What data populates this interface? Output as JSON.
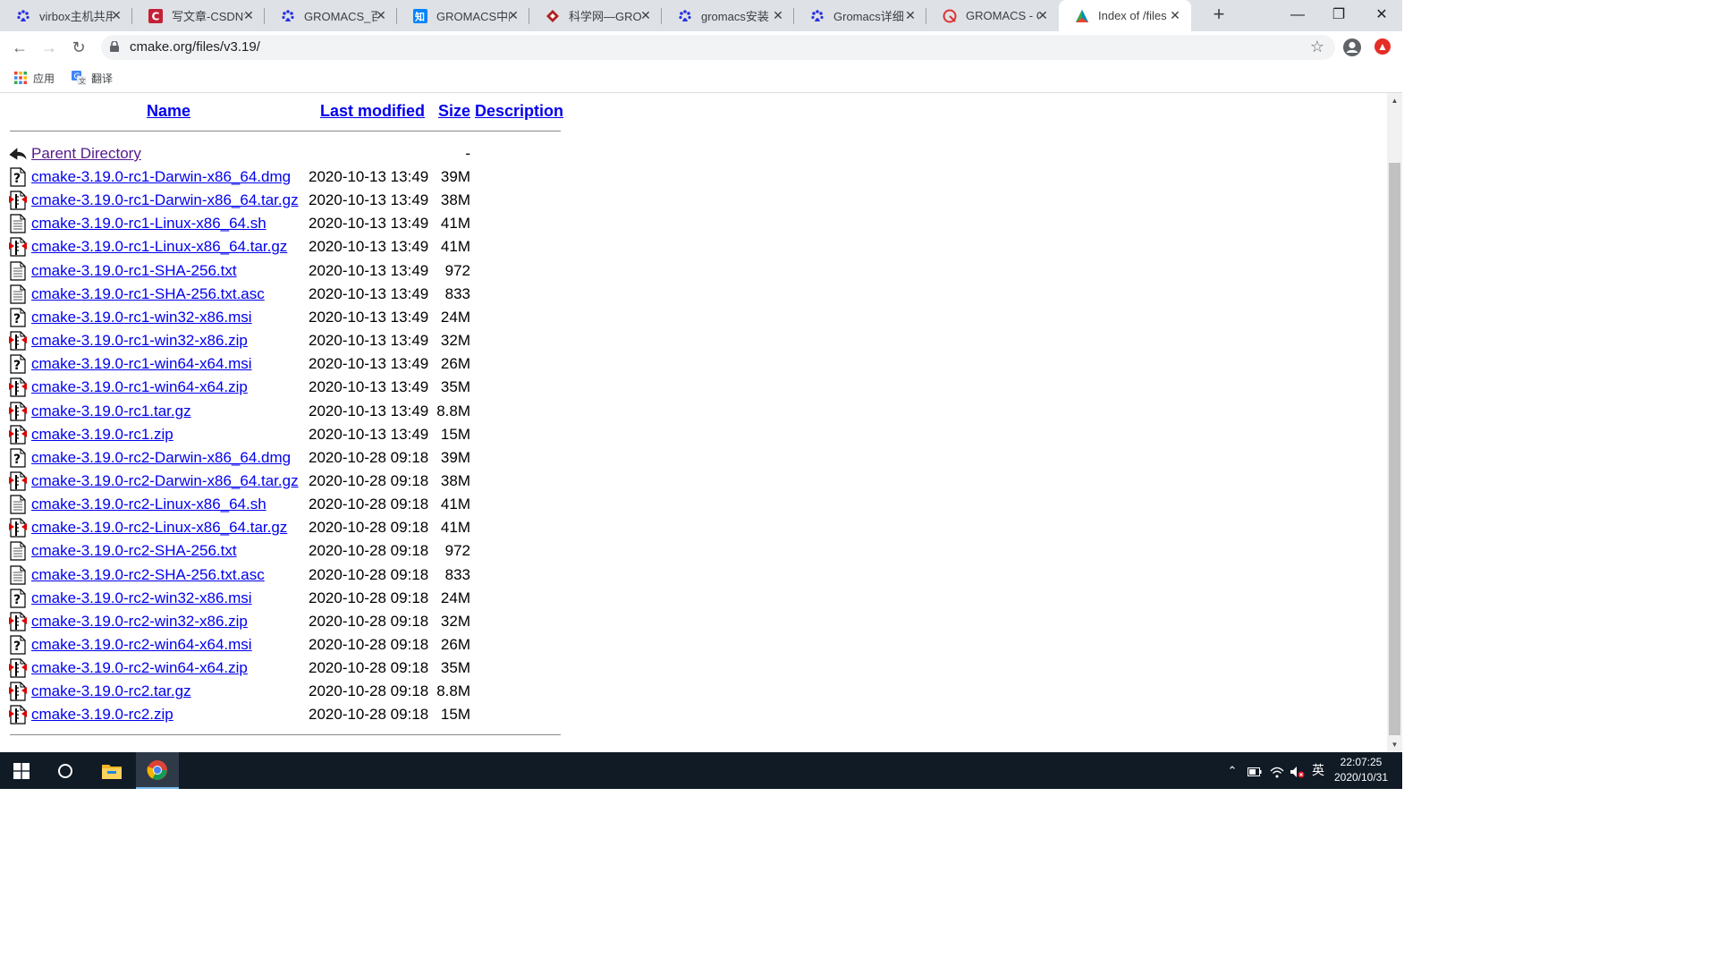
{
  "tabs": [
    {
      "title": "virbox主机共用",
      "icon": "baidu-paw-icon",
      "active": false
    },
    {
      "title": "写文章-CSDN博",
      "icon": "csdn-icon",
      "active": false
    },
    {
      "title": "GROMACS_百",
      "icon": "baidu-paw-icon",
      "active": false
    },
    {
      "title": "GROMACS中的",
      "icon": "zhihu-icon",
      "active": false
    },
    {
      "title": "科学网—GRO",
      "icon": "sciencenet-icon",
      "active": false
    },
    {
      "title": "gromacs安装",
      "icon": "baidu-paw-icon",
      "active": false
    },
    {
      "title": "Gromacs详细",
      "icon": "baidu-paw-icon",
      "active": false
    },
    {
      "title": "GROMACS - C",
      "icon": "gromacs-icon",
      "active": false
    },
    {
      "title": "Index of /files",
      "icon": "cmake-triangle-icon",
      "active": true
    }
  ],
  "address_bar": {
    "url": "cmake.org/files/v3.19/"
  },
  "bookmarks": [
    {
      "label": "应用",
      "icon": "apps-grid-icon"
    },
    {
      "label": "翻译",
      "icon": "translate-icon"
    }
  ],
  "listing": {
    "headers": {
      "name": "Name",
      "last_modified": "Last modified",
      "size": "Size",
      "description": "Description"
    },
    "parent": {
      "name": "Parent Directory",
      "size": "-",
      "icon": "back-arrow-icon"
    },
    "files": [
      {
        "name": "cmake-3.19.0-rc1-Darwin-x86_64.dmg",
        "modified": "2020-10-13 13:49",
        "size": "39M",
        "icon": "unknown-file-icon"
      },
      {
        "name": "cmake-3.19.0-rc1-Darwin-x86_64.tar.gz",
        "modified": "2020-10-13 13:49",
        "size": "38M",
        "icon": "compressed-file-icon"
      },
      {
        "name": "cmake-3.19.0-rc1-Linux-x86_64.sh",
        "modified": "2020-10-13 13:49",
        "size": "41M",
        "icon": "text-file-icon"
      },
      {
        "name": "cmake-3.19.0-rc1-Linux-x86_64.tar.gz",
        "modified": "2020-10-13 13:49",
        "size": "41M",
        "icon": "compressed-file-icon"
      },
      {
        "name": "cmake-3.19.0-rc1-SHA-256.txt",
        "modified": "2020-10-13 13:49",
        "size": "972",
        "icon": "text-file-icon"
      },
      {
        "name": "cmake-3.19.0-rc1-SHA-256.txt.asc",
        "modified": "2020-10-13 13:49",
        "size": "833",
        "icon": "text-file-icon"
      },
      {
        "name": "cmake-3.19.0-rc1-win32-x86.msi",
        "modified": "2020-10-13 13:49",
        "size": "24M",
        "icon": "unknown-file-icon"
      },
      {
        "name": "cmake-3.19.0-rc1-win32-x86.zip",
        "modified": "2020-10-13 13:49",
        "size": "32M",
        "icon": "compressed-file-icon"
      },
      {
        "name": "cmake-3.19.0-rc1-win64-x64.msi",
        "modified": "2020-10-13 13:49",
        "size": "26M",
        "icon": "unknown-file-icon"
      },
      {
        "name": "cmake-3.19.0-rc1-win64-x64.zip",
        "modified": "2020-10-13 13:49",
        "size": "35M",
        "icon": "compressed-file-icon"
      },
      {
        "name": "cmake-3.19.0-rc1.tar.gz",
        "modified": "2020-10-13 13:49",
        "size": "8.8M",
        "icon": "compressed-file-icon"
      },
      {
        "name": "cmake-3.19.0-rc1.zip",
        "modified": "2020-10-13 13:49",
        "size": "15M",
        "icon": "compressed-file-icon"
      },
      {
        "name": "cmake-3.19.0-rc2-Darwin-x86_64.dmg",
        "modified": "2020-10-28 09:18",
        "size": "39M",
        "icon": "unknown-file-icon"
      },
      {
        "name": "cmake-3.19.0-rc2-Darwin-x86_64.tar.gz",
        "modified": "2020-10-28 09:18",
        "size": "38M",
        "icon": "compressed-file-icon"
      },
      {
        "name": "cmake-3.19.0-rc2-Linux-x86_64.sh",
        "modified": "2020-10-28 09:18",
        "size": "41M",
        "icon": "text-file-icon"
      },
      {
        "name": "cmake-3.19.0-rc2-Linux-x86_64.tar.gz",
        "modified": "2020-10-28 09:18",
        "size": "41M",
        "icon": "compressed-file-icon"
      },
      {
        "name": "cmake-3.19.0-rc2-SHA-256.txt",
        "modified": "2020-10-28 09:18",
        "size": "972",
        "icon": "text-file-icon"
      },
      {
        "name": "cmake-3.19.0-rc2-SHA-256.txt.asc",
        "modified": "2020-10-28 09:18",
        "size": "833",
        "icon": "text-file-icon"
      },
      {
        "name": "cmake-3.19.0-rc2-win32-x86.msi",
        "modified": "2020-10-28 09:18",
        "size": "24M",
        "icon": "unknown-file-icon"
      },
      {
        "name": "cmake-3.19.0-rc2-win32-x86.zip",
        "modified": "2020-10-28 09:18",
        "size": "32M",
        "icon": "compressed-file-icon"
      },
      {
        "name": "cmake-3.19.0-rc2-win64-x64.msi",
        "modified": "2020-10-28 09:18",
        "size": "26M",
        "icon": "unknown-file-icon"
      },
      {
        "name": "cmake-3.19.0-rc2-win64-x64.zip",
        "modified": "2020-10-28 09:18",
        "size": "35M",
        "icon": "compressed-file-icon"
      },
      {
        "name": "cmake-3.19.0-rc2.tar.gz",
        "modified": "2020-10-28 09:18",
        "size": "8.8M",
        "icon": "compressed-file-icon"
      },
      {
        "name": "cmake-3.19.0-rc2.zip",
        "modified": "2020-10-28 09:18",
        "size": "15M",
        "icon": "compressed-file-icon"
      }
    ]
  },
  "taskbar": {
    "items": [
      {
        "name": "start-button",
        "icon": "windows-logo-icon"
      },
      {
        "name": "search-button",
        "icon": "cortana-circle-icon"
      },
      {
        "name": "file-explorer",
        "icon": "folder-icon"
      },
      {
        "name": "chrome",
        "icon": "chrome-icon"
      }
    ],
    "ime": "英",
    "time": "22:07:25",
    "date": "2020/10/31"
  },
  "colors": {
    "link": "#0000ee",
    "visited": "#551a8b",
    "tab_strip": "#dee1e6",
    "taskbar": "#101b26"
  }
}
